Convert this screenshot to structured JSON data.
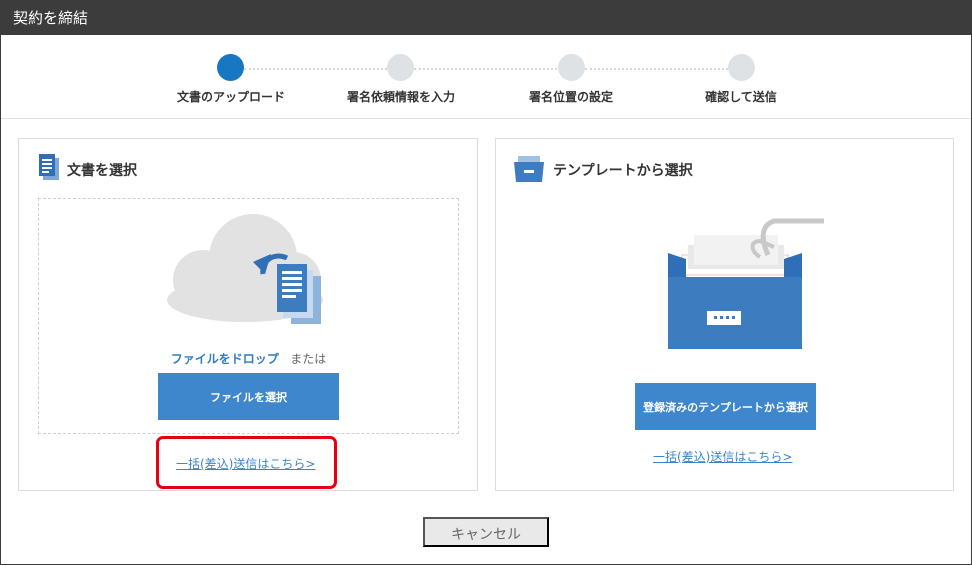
{
  "window": {
    "title": "契約を締結"
  },
  "steps": [
    {
      "label": "文書のアップロード",
      "active": true
    },
    {
      "label": "署名依頼情報を入力",
      "active": false
    },
    {
      "label": "署名位置の設定",
      "active": false
    },
    {
      "label": "確認して送信",
      "active": false
    }
  ],
  "document_panel": {
    "title": "文書を選択",
    "drop_text": "ファイルをドロップ",
    "drop_or": "または",
    "select_button": "ファイルを選択",
    "bulk_link": "一括(差込)送信はこちら>"
  },
  "template_panel": {
    "title": "テンプレートから選択",
    "select_button": "登録済みのテンプレートから選択",
    "bulk_link": "一括(差込)送信はこちら>"
  },
  "footer": {
    "cancel_label": "キャンセル"
  },
  "colors": {
    "accent": "#1877c2",
    "button": "#3f87cc",
    "highlight": "#e60012",
    "titlebar": "#3c3c3c"
  }
}
